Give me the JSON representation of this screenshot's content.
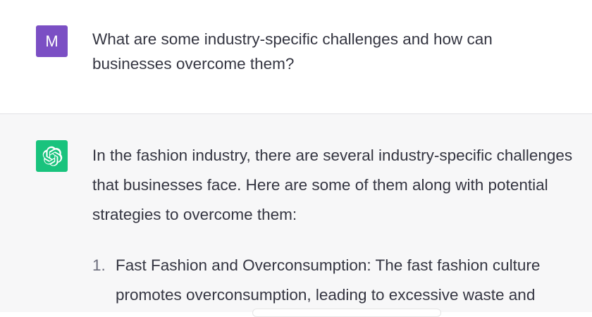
{
  "user_message": {
    "avatar_letter": "M",
    "avatar_color": "#7b4fc4",
    "text": "What are some industry-specific challenges and how can businesses overcome them?"
  },
  "assistant_message": {
    "avatar_icon": "openai-logo-icon",
    "avatar_color": "#19c37d",
    "intro": "In the fashion industry, there are several industry-specific challenges that businesses face. Here are some of them along with potential strategies to overcome them:",
    "list": [
      {
        "number": "1.",
        "text": "Fast Fashion and Overconsumption: The fast fashion culture promotes overconsumption, leading to excessive waste and"
      }
    ]
  }
}
